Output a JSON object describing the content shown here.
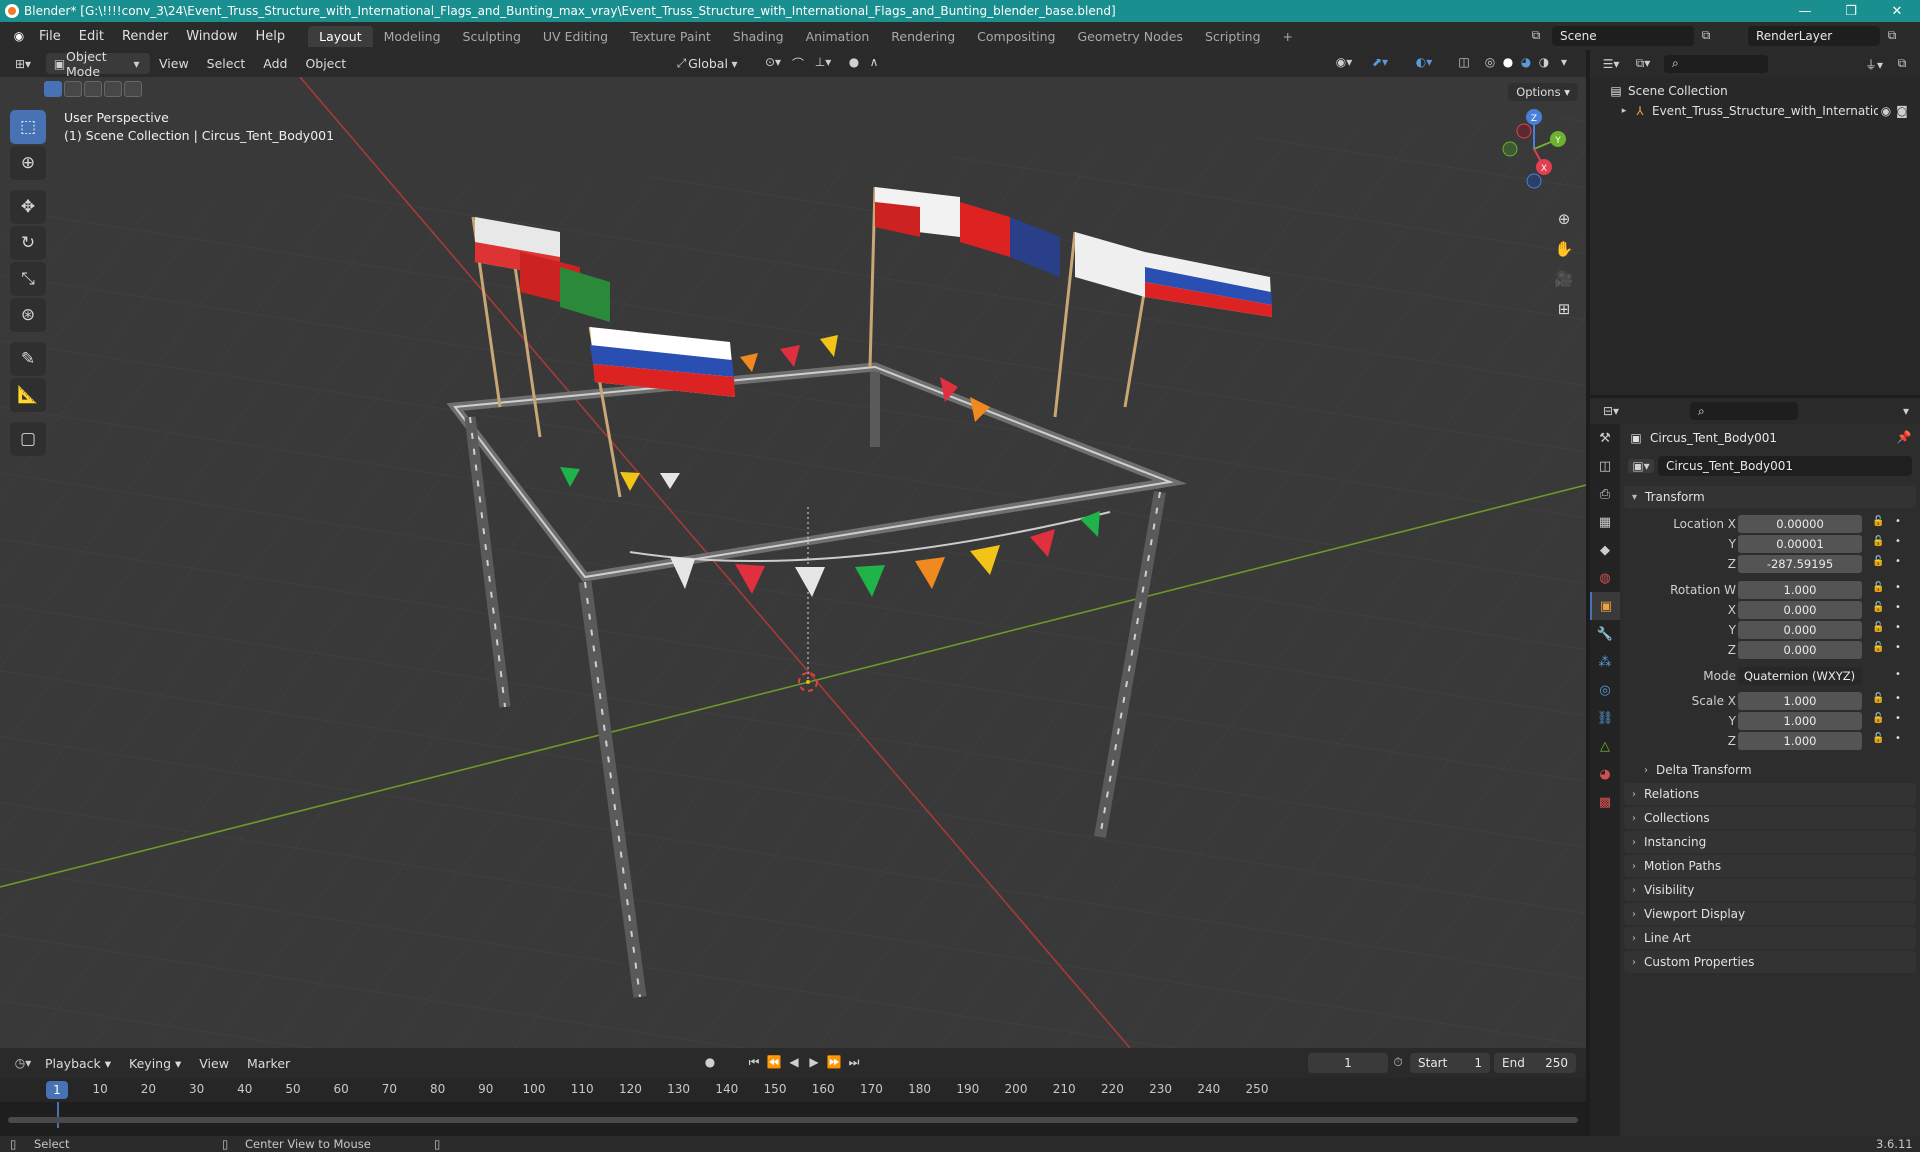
{
  "window": {
    "title": "Blender* [G:\\!!!!conv_3\\24\\Event_Truss_Structure_with_International_Flags_and_Bunting_max_vray\\Event_Truss_Structure_with_International_Flags_and_Bunting_blender_base.blend]",
    "minimize": "—",
    "maximize": "❐",
    "close": "✕"
  },
  "menubar": {
    "menus": [
      "File",
      "Edit",
      "Render",
      "Window",
      "Help"
    ],
    "workspaces": [
      "Layout",
      "Modeling",
      "Sculpting",
      "UV Editing",
      "Texture Paint",
      "Shading",
      "Animation",
      "Rendering",
      "Compositing",
      "Geometry Nodes",
      "Scripting"
    ],
    "active_workspace": "Layout",
    "add_workspace": "+",
    "scene": "Scene",
    "view_layer": "RenderLayer"
  },
  "viewport_header": {
    "mode": "Object Mode",
    "menus": [
      "View",
      "Select",
      "Add",
      "Object"
    ],
    "orientation": "Global",
    "options": "Options"
  },
  "viewport": {
    "perspective": "User Perspective",
    "context": "(1) Scene Collection | Circus_Tent_Body001",
    "gizmo": {
      "x": "X",
      "y": "Y",
      "z": "Z"
    }
  },
  "timeline": {
    "menus": [
      "Playback",
      "Keying",
      "View",
      "Marker"
    ],
    "current_frame": "1",
    "start_label": "Start",
    "start": "1",
    "end_label": "End",
    "end": "250",
    "ruler": [
      "10",
      "20",
      "30",
      "40",
      "50",
      "60",
      "70",
      "80",
      "90",
      "100",
      "110",
      "120",
      "130",
      "140",
      "150",
      "160",
      "170",
      "180",
      "190",
      "200",
      "210",
      "220",
      "230",
      "240",
      "250"
    ],
    "playhead": "1"
  },
  "statusbar": {
    "select": "Select",
    "center": "Center View to Mouse",
    "version": "3.6.11"
  },
  "outliner": {
    "root": "Scene Collection",
    "items": [
      "Event_Truss_Structure_with_Internation"
    ]
  },
  "properties": {
    "object_name": "Circus_Tent_Body001",
    "data_name": "Circus_Tent_Body001",
    "transform_title": "Transform",
    "location": [
      {
        "label": "Location X",
        "value": "0.00000"
      },
      {
        "label": "Y",
        "value": "0.00001"
      },
      {
        "label": "Z",
        "value": "-287.59195"
      }
    ],
    "rotation": [
      {
        "label": "Rotation W",
        "value": "1.000"
      },
      {
        "label": "X",
        "value": "0.000"
      },
      {
        "label": "Y",
        "value": "0.000"
      },
      {
        "label": "Z",
        "value": "0.000"
      }
    ],
    "mode_label": "Mode",
    "mode_value": "Quaternion (WXYZ)",
    "scale": [
      {
        "label": "Scale X",
        "value": "1.000"
      },
      {
        "label": "Y",
        "value": "1.000"
      },
      {
        "label": "Z",
        "value": "1.000"
      }
    ],
    "delta_transform": "Delta Transform",
    "panels": [
      "Relations",
      "Collections",
      "Instancing",
      "Motion Paths",
      "Visibility",
      "Viewport Display",
      "Line Art",
      "Custom Properties"
    ]
  }
}
